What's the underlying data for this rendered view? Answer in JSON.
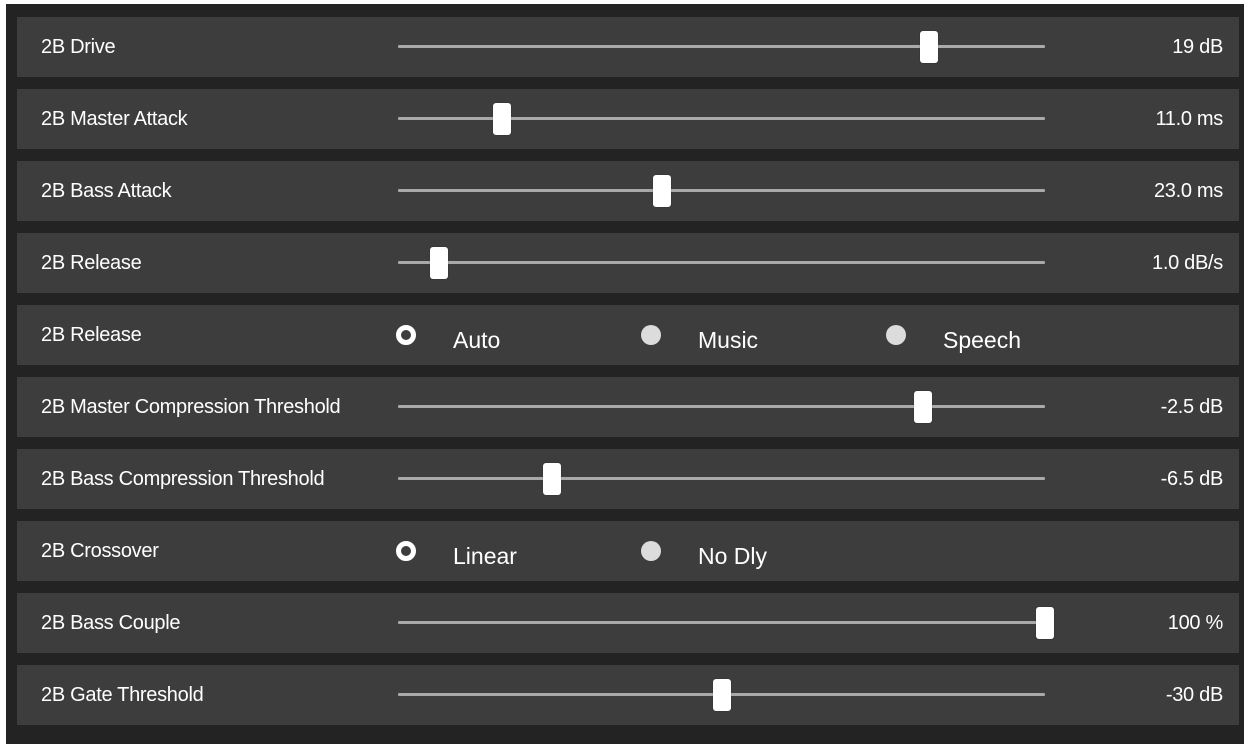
{
  "rows": [
    {
      "type": "slider",
      "label": "2B Drive",
      "value": "19 dB",
      "level": 0.82
    },
    {
      "type": "slider",
      "label": "2B Master Attack",
      "value": "11.0 ms",
      "level": 0.16
    },
    {
      "type": "slider",
      "label": "2B Bass Attack",
      "value": "23.0 ms",
      "level": 0.408
    },
    {
      "type": "slider",
      "label": "2B Release",
      "value": "1.0 dB/s",
      "level": 0.063
    },
    {
      "type": "radio",
      "label": "2B Release",
      "selected": 0,
      "options": [
        "Auto",
        "Music",
        "Speech"
      ]
    },
    {
      "type": "slider",
      "label": "2B Master Compression Threshold",
      "value": "-2.5 dB",
      "level": 0.811
    },
    {
      "type": "slider",
      "label": "2B Bass Compression Threshold",
      "value": "-6.5 dB",
      "level": 0.238
    },
    {
      "type": "radio",
      "label": "2B Crossover",
      "selected": 0,
      "options": [
        "Linear",
        "No Dly"
      ]
    },
    {
      "type": "slider",
      "label": "2B Bass Couple",
      "value": "100 %",
      "level": 1.0
    },
    {
      "type": "slider",
      "label": "2B Gate Threshold",
      "value": "-30 dB",
      "level": 0.5
    }
  ],
  "colors": {
    "background": "#232323",
    "row": "#3d3d3d",
    "track": "#a9a9a9",
    "thumb": "#ffffff",
    "text": "#ffffff"
  }
}
